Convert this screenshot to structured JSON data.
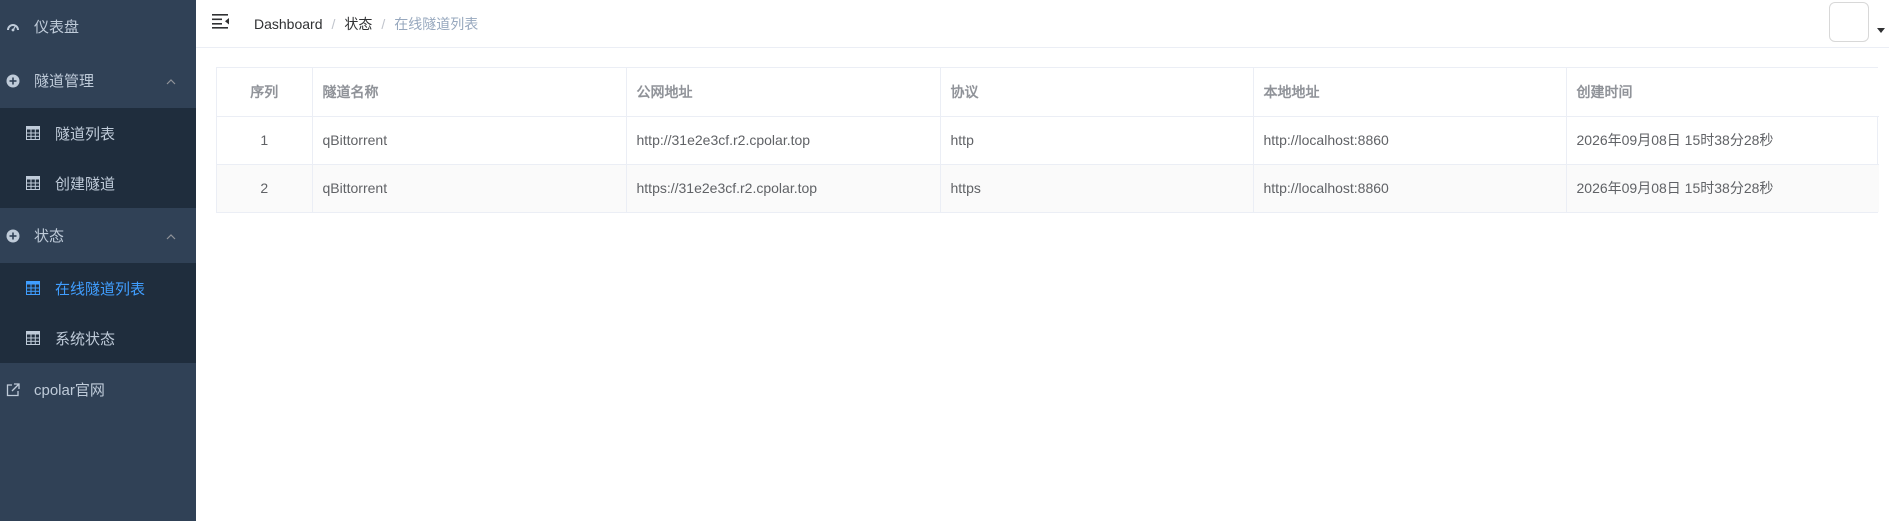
{
  "sidebar": {
    "dashboard": "仪表盘",
    "tunnel_mgmt": {
      "title": "隧道管理",
      "items": [
        "隧道列表",
        "创建隧道"
      ]
    },
    "status": {
      "title": "状态",
      "items": [
        "在线隧道列表",
        "系统状态"
      ]
    },
    "external": "cpolar官网",
    "active_item": "在线隧道列表",
    "active_color": "#409eff"
  },
  "navbar": {
    "breadcrumb": [
      "Dashboard",
      "状态",
      "在线隧道列表"
    ],
    "separator": "/"
  },
  "table": {
    "columns": [
      "序列",
      "隧道名称",
      "公网地址",
      "协议",
      "本地地址",
      "创建时间"
    ],
    "rows": [
      [
        "1",
        "qBittorrent",
        "http://31e2e3cf.r2.cpolar.top",
        "http",
        "http://localhost:8860",
        "2026年09月08日 15时38分28秒"
      ],
      [
        "2",
        "qBittorrent",
        "https://31e2e3cf.r2.cpolar.top",
        "https",
        "http://localhost:8860",
        "2026年09月08日 15时38分28秒"
      ]
    ]
  }
}
